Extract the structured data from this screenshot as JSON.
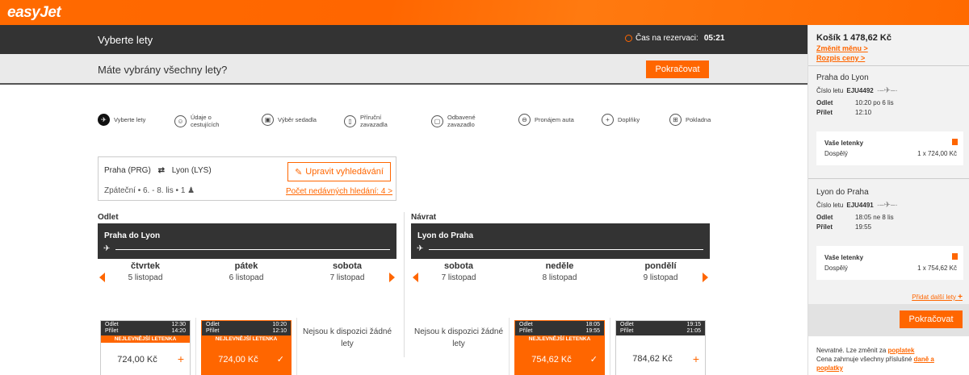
{
  "app": {
    "logo": "easyJet"
  },
  "header": {
    "title": "Vyberte lety",
    "timer_label": "Čas na rezervaci:",
    "timer_value": "05:21"
  },
  "banner": {
    "question": "Máte vybrány všechny lety?",
    "continue": "Pokračovat"
  },
  "steps": [
    {
      "label": "Vyberte lety",
      "icon": "plane-icon"
    },
    {
      "label": "Údaje o cestujících",
      "icon": "person-icon"
    },
    {
      "label": "Výběr sedadla",
      "icon": "seat-icon"
    },
    {
      "label": "Příruční zavazadla",
      "icon": "cabin-bag-icon"
    },
    {
      "label": "Odbavené zavazadlo",
      "icon": "hold-bag-icon"
    },
    {
      "label": "Pronájem auta",
      "icon": "car-icon"
    },
    {
      "label": "Doplňky",
      "icon": "plus-icon"
    },
    {
      "label": "Pokladna",
      "icon": "basket-icon"
    }
  ],
  "search": {
    "from": "Praha (PRG)",
    "to": "Lyon (LYS)",
    "summary": "Zpáteční • 6. - 8. lis • 1",
    "edit": "Upravit vyhledávání",
    "recent": "Počet nedávných hledání: 4 >"
  },
  "outbound": {
    "label": "Odlet",
    "route": "Praha do Lyon",
    "days": [
      {
        "name": "čtvrtek",
        "date": "5 listopad"
      },
      {
        "name": "pátek",
        "date": "6 listopad"
      },
      {
        "name": "sobota",
        "date": "7 listopad"
      }
    ],
    "cards": [
      {
        "dep_label": "Odlet",
        "dep": "12:30",
        "arr_label": "Přílet",
        "arr": "14:20",
        "tag": "NEJLEVNĚJŠÍ LETENKA",
        "price": "724,00 Kč"
      },
      {
        "dep_label": "Odlet",
        "dep": "10:20",
        "arr_label": "Přílet",
        "arr": "12:10",
        "tag": "NEJLEVNĚJŠÍ LETENKA",
        "price": "724,00 Kč"
      }
    ],
    "no_flights": "Nejsou k dispozici žádné lety"
  },
  "return": {
    "label": "Návrat",
    "route": "Lyon do Praha",
    "days": [
      {
        "name": "sobota",
        "date": "7 listopad"
      },
      {
        "name": "neděle",
        "date": "8 listopad"
      },
      {
        "name": "pondělí",
        "date": "9 listopad"
      }
    ],
    "cards": [
      {
        "dep_label": "Odlet",
        "dep": "18:05",
        "arr_label": "Přílet",
        "arr": "19:55",
        "tag": "NEJLEVNĚJŠÍ LETENKA",
        "price": "754,62 Kč"
      },
      {
        "dep_label": "Odlet",
        "dep": "19:15",
        "arr_label": "Přílet",
        "arr": "21:05",
        "price": "784,62 Kč"
      }
    ],
    "no_flights": "Nejsou k dispozici žádné lety"
  },
  "sidebar": {
    "total": "Košík 1 478,62 Kč",
    "change_currency": "Změnit měnu >",
    "price_breakdown": "Rozpis ceny >",
    "flights": [
      {
        "route": "Praha do Lyon",
        "flight_no_label": "Číslo letu",
        "flight_no": "EJU4492",
        "dep_label": "Odlet",
        "dep": "10:20 po 6 lis",
        "arr_label": "Přílet",
        "arr": "12:10",
        "tickets_label": "Vaše letenky",
        "pax": "Dospělý",
        "amount": "1 x 724,00 Kč"
      },
      {
        "route": "Lyon do Praha",
        "flight_no_label": "Číslo letu",
        "flight_no": "EJU4491",
        "dep_label": "Odlet",
        "dep": "18:05 ne 8 lis",
        "arr_label": "Přílet",
        "arr": "19:55",
        "tickets_label": "Vaše letenky",
        "pax": "Dospělý",
        "amount": "1 x 754,62 Kč"
      }
    ],
    "add_flight": "Přidat další lety",
    "continue": "Pokračovat",
    "footer_1": "Nevratné. Lze změnit za",
    "footer_fees": "poplatek",
    "footer_2": "Cena zahrnuje všechny příslušné",
    "footer_taxes": "daně a poplatky"
  },
  "colors": {
    "brand": "#ff6600",
    "dark": "#333333"
  }
}
